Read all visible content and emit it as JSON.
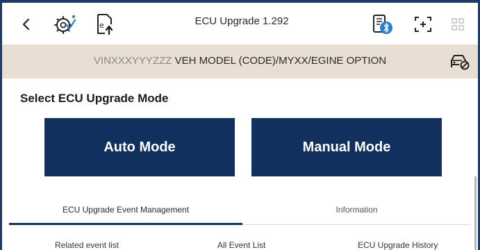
{
  "header": {
    "title": "ECU Upgrade 1.292",
    "icons": [
      "back-arrow-icon",
      "vci-settings-icon",
      "ecu-upload-icon",
      "bluetooth-device-icon",
      "screenshot-icon",
      "grid-menu-icon"
    ]
  },
  "vehicle_bar": {
    "vin": "VINXXXYYYZZZ",
    "info": "VEH MODEL (CODE)/MYXX/EGINE OPTION",
    "icon": "vehicle-status-icon"
  },
  "main": {
    "section_title": "Select ECU Upgrade Mode",
    "auto_mode_label": "Auto Mode",
    "manual_mode_label": "Manual Mode"
  },
  "tabs": [
    {
      "label": "ECU Upgrade Event Management",
      "active": true
    },
    {
      "label": "Information",
      "active": false
    }
  ],
  "subtabs": [
    {
      "label": "Related event list"
    },
    {
      "label": "All Event List"
    },
    {
      "label": "ECU Upgrade History"
    }
  ],
  "colors": {
    "primary": "#11305e",
    "frame": "#1c3b66",
    "vin_bar": "#e9ded3",
    "bluetooth": "#2a7fd4"
  }
}
